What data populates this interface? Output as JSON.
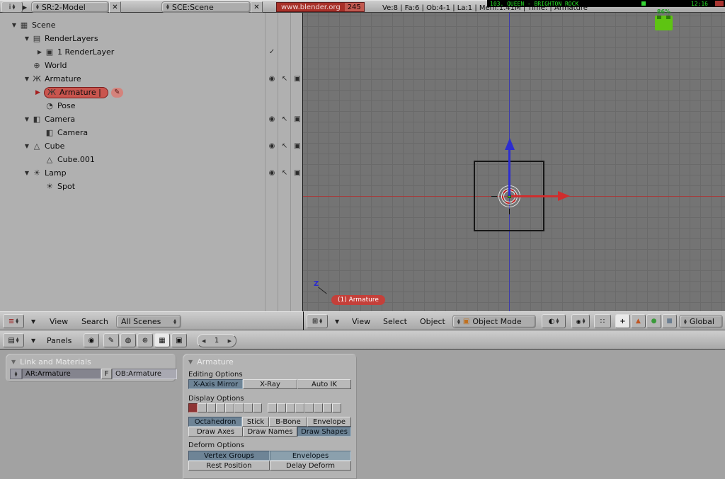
{
  "colors": {
    "selection_red": "#c9554e",
    "version_red": "#a83028",
    "toggle_pressed_blue": "#6e8496",
    "axis_x_red": "#cf2d2d",
    "axis_z_blue": "#2d2dcf",
    "overlay_green": "#27e527"
  },
  "icons": {
    "info": "i",
    "outliner": "≡",
    "viewport": "⊞",
    "buttons_win": "▤",
    "close": "✕",
    "scene": "▦",
    "renderlayers": "▤",
    "renderlayer": "▣",
    "world": "⊕",
    "armature": "Ж",
    "pose": "◔",
    "camera": "◧",
    "mesh": "△",
    "lamp": "☀",
    "eye": "◉",
    "select_arrow": "↖",
    "render": "▣",
    "check": "✓",
    "bullet": "▶",
    "pencil": "✎",
    "mode_cube": "▣",
    "shading_sphere": "◐",
    "pivot": "◉",
    "snap": "∷",
    "hand": "+",
    "manip_translate": "▲",
    "manip_rotate": "●",
    "manip_scale": "■",
    "lens": "◉",
    "script": "✎",
    "shading_ctx": "◍",
    "object_ctx": "⊕",
    "editing_ctx": "▦",
    "scene_ctx": "▣",
    "spin_left": "◀",
    "spin_right": "▶"
  },
  "topbar": {
    "screen": "SR:2-Model",
    "scene": "SCE:Scene",
    "version": "www.blender.org",
    "build": "245",
    "stats": "Ve:8 | Fa:6 | Ob:4-1 | La:1 | Mem:1.41M | Time: | Armature"
  },
  "overlay": {
    "song": "103. QUEEN - BRIGHTON ROCK",
    "clock": "12:16",
    "battery": "86%"
  },
  "outliner": {
    "tree": [
      "Scene",
      "RenderLayers",
      "1 RenderLayer",
      "World",
      "Armature",
      "Armature |",
      "Pose",
      "Camera",
      "Camera",
      "Cube",
      "Cube.001",
      "Lamp",
      "Spot"
    ],
    "header": {
      "view": "View",
      "search": "Search",
      "filter": "All Scenes"
    }
  },
  "viewport": {
    "header": {
      "view": "View",
      "select": "Select",
      "object": "Object",
      "mode": "Object Mode",
      "orientation": "Global"
    },
    "active_object": "(1) Armature",
    "axis_label": "Z"
  },
  "buttons": {
    "header": {
      "panels": "Panels",
      "frame": "1"
    },
    "link_panel": {
      "title": "Link and Materials",
      "ar": "AR:Armature",
      "f": "F",
      "ob": "OB:Armature"
    },
    "armature_panel": {
      "title": "Armature",
      "editing_label": "Editing Options",
      "editing": [
        "X-Axis Mirror",
        "X-Ray",
        "Auto IK"
      ],
      "display_label": "Display Options",
      "drawtype": [
        "Octahedron",
        "Stick",
        "B-Bone",
        "Envelope"
      ],
      "draw": [
        "Draw Axes",
        "Draw Names",
        "Draw Shapes"
      ],
      "deform_label": "Deform Options",
      "deform": [
        "Vertex Groups",
        "Envelopes",
        "Rest Position",
        "Delay Deform"
      ]
    }
  }
}
